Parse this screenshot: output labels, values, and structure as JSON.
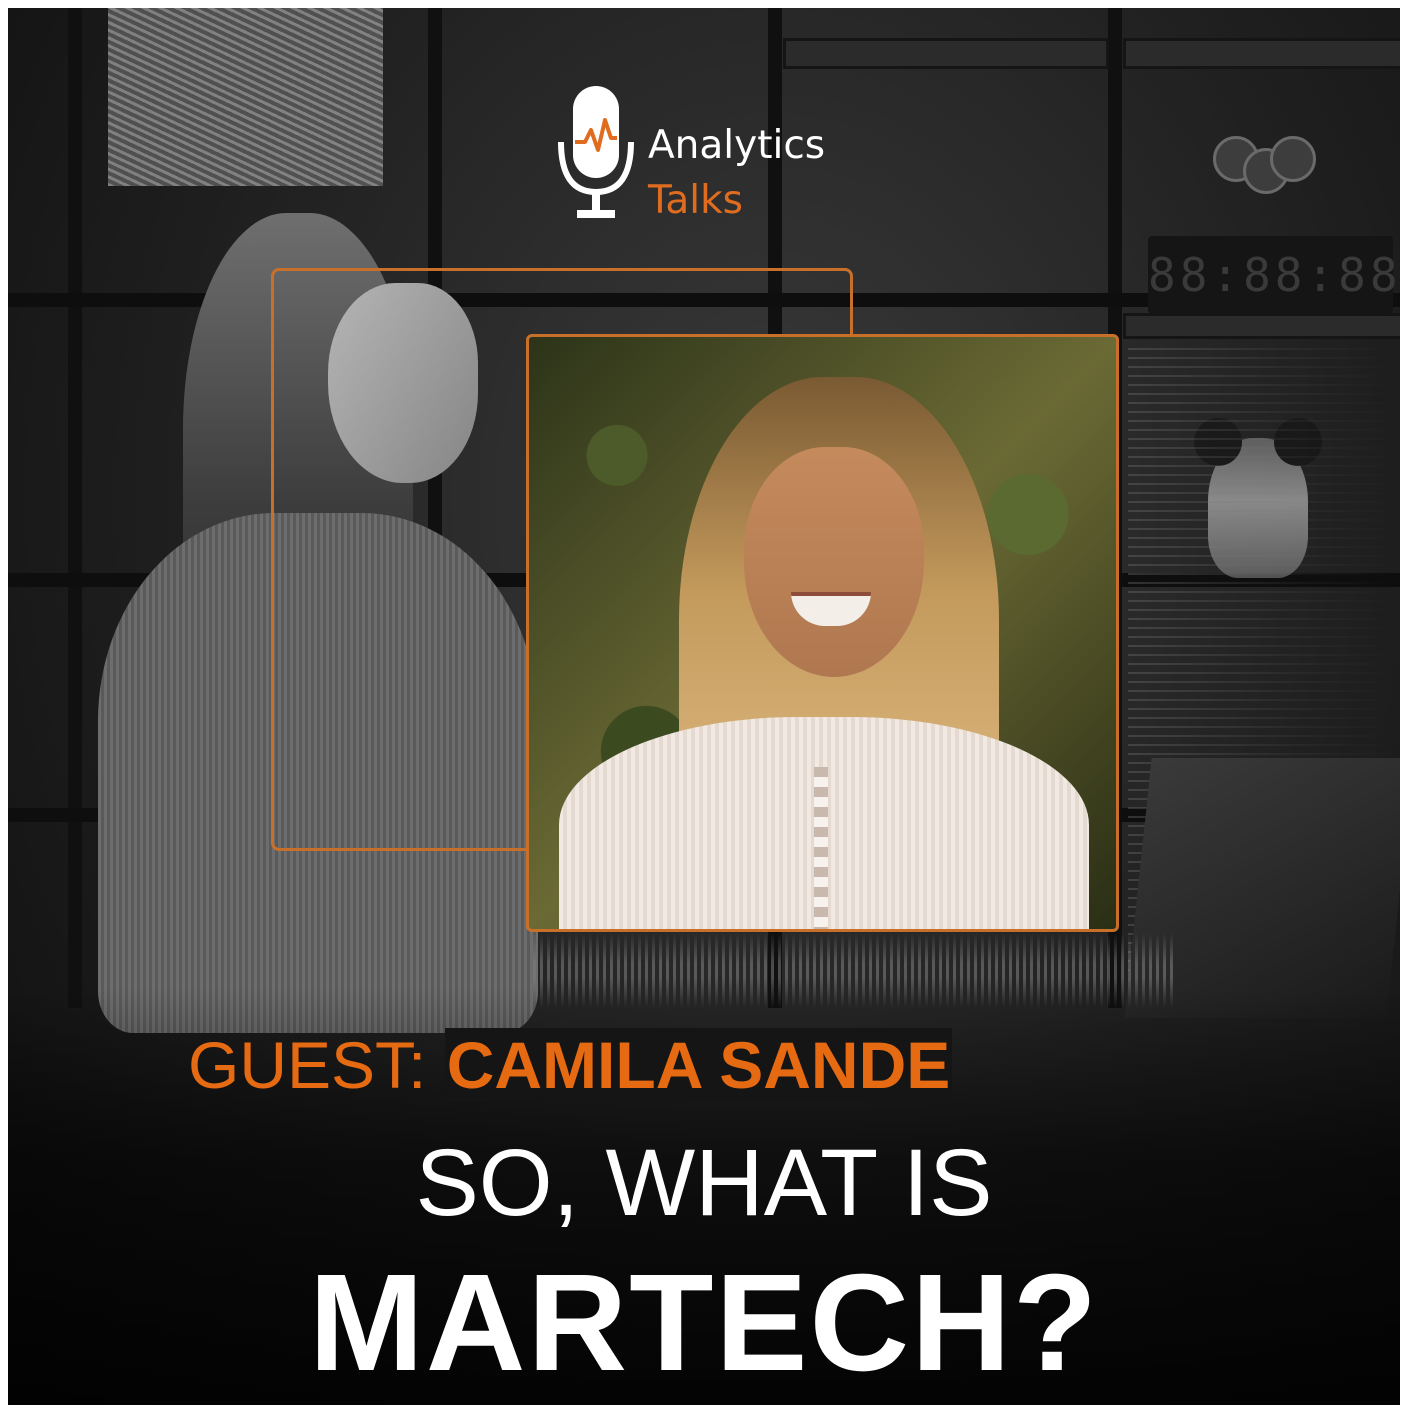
{
  "logo": {
    "line1": "Analytics",
    "line2": "Talks",
    "icon": "microphone-chart-icon",
    "accent_color": "#e06d1f"
  },
  "background": {
    "clock_display": "88:88:88"
  },
  "guest": {
    "label": "GUEST:",
    "name": "CAMILA SANDE",
    "color": "#e56a12"
  },
  "headline": {
    "subtitle": "SO, WHAT IS",
    "title": "MARTECH?"
  },
  "frame_color": "#c8702a"
}
